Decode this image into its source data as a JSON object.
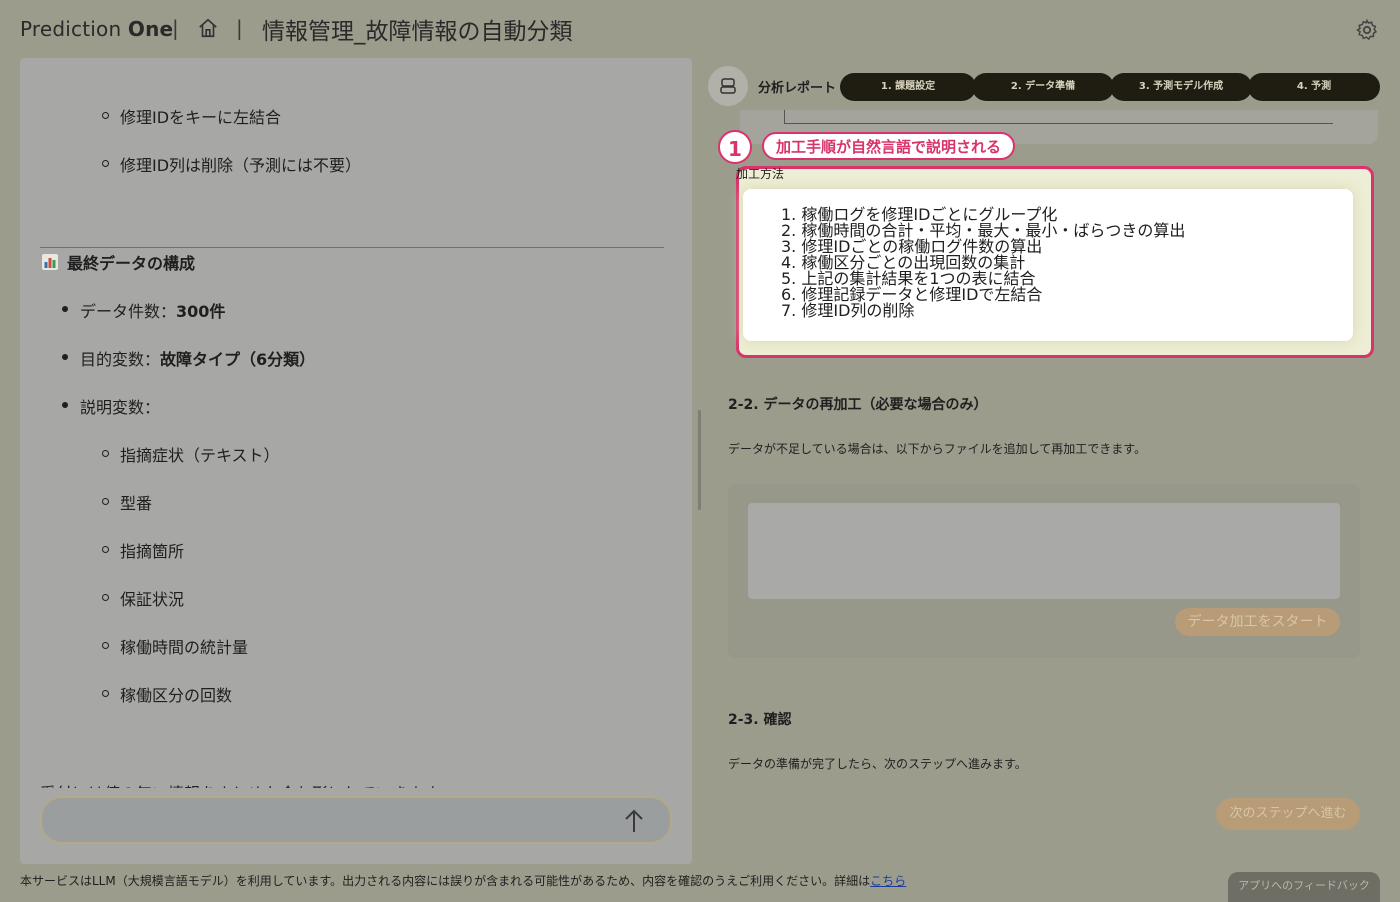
{
  "header": {
    "brand_part1": "Prediction ",
    "brand_part2": "One",
    "separator": "|",
    "page_title": "情報管理_故障情報の自動分類"
  },
  "chat": {
    "lines": [
      "修理IDをキーに左結合",
      "修理ID列は削除（予測には不要）"
    ],
    "final_heading": "最終データの構成",
    "data_count_label": "データ件数：",
    "data_count_value": "300件",
    "target_label": "目的変数：",
    "target_value": "故障タイプ（6分類）",
    "explanatory_label": "説明変数：",
    "explanatory_items": [
      "指摘症状（テキスト）",
      "型番",
      "指摘箇所",
      "保証状況",
      "稼働時間の統計量",
      "稼働区分の回数"
    ],
    "cut_text": "受付には値の無い情報をまとめた含む形にしていきます",
    "input_placeholder": ""
  },
  "report": {
    "label": "分析レポート",
    "steps": [
      "1. 課題設定",
      "2. データ準備",
      "3. 予測モデル作成",
      "4. 予測"
    ],
    "callout_number": "1",
    "callout_text": "加工手順が自然言語で説明される",
    "method_label": "加工方法",
    "process_steps": [
      "1. 稼働ログを修理IDごとにグループ化",
      "2. 稼働時間の合計・平均・最大・最小・ばらつきの算出",
      "3. 修理IDごとの稼働ログ件数の算出",
      "4. 稼働区分ごとの出現回数の集計",
      "5. 上記の集計結果を1つの表に結合",
      "6. 修理記録データと修理IDで左結合",
      "7. 修理ID列の削除"
    ],
    "reprocess_title": "2-2. データの再加工（必要な場合のみ）",
    "reprocess_desc": "データが不足している場合は、以下からファイルを追加して再加工できます。",
    "start_button": "データ加工をスタート",
    "confirm_title": "2-3. 確認",
    "confirm_desc": "データの準備が完了したら、次のステップへ進みます。",
    "next_button": "次のステップへ進む"
  },
  "footer": {
    "note": "本サービスはLLM（大規模言語モデル）を利用しています。出力される内容には誤りが含まれる可能性があるため、内容を確認のうえご利用ください。詳細は",
    "link": "こちら",
    "feedback": "アプリへのフィードバック"
  }
}
